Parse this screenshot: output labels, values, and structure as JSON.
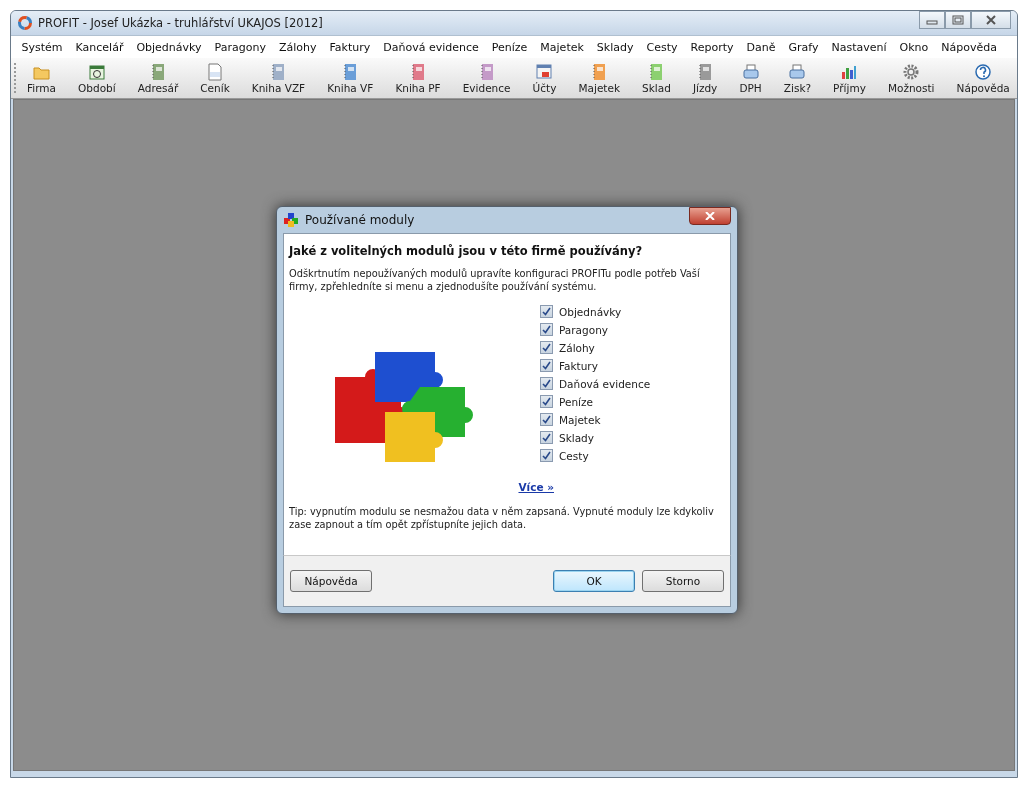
{
  "window": {
    "title": "PROFIT - Josef Ukázka - truhlářství UKAJOS [2012]"
  },
  "menu": [
    "Systém",
    "Kancelář",
    "Objednávky",
    "Paragony",
    "Zálohy",
    "Faktury",
    "Daňová evidence",
    "Peníze",
    "Majetek",
    "Sklady",
    "Cesty",
    "Reporty",
    "Daně",
    "Grafy",
    "Nastavení",
    "Okno",
    "Nápověda"
  ],
  "toolbar": [
    {
      "label": "Firma",
      "kind": "folder"
    },
    {
      "label": "Období",
      "kind": "calendar"
    },
    {
      "label": "Adresář",
      "kind": "book",
      "color": "#8aa87a"
    },
    {
      "label": "Ceník",
      "kind": "pricelist"
    },
    {
      "label": "Kniha VZF",
      "kind": "book",
      "color": "#9fb0c8"
    },
    {
      "label": "Kniha VF",
      "kind": "book",
      "color": "#6a9ed8"
    },
    {
      "label": "Kniha PF",
      "kind": "book",
      "color": "#e07a8a"
    },
    {
      "label": "Evidence",
      "kind": "book",
      "color": "#c49ac8"
    },
    {
      "label": "Účty",
      "kind": "accounts"
    },
    {
      "label": "Majetek",
      "kind": "book",
      "color": "#f0a050"
    },
    {
      "label": "Sklad",
      "kind": "book",
      "color": "#8cd070"
    },
    {
      "label": "Jízdy",
      "kind": "book",
      "color": "#9a9a9a"
    },
    {
      "label": "DPH",
      "kind": "printer"
    },
    {
      "label": "Zisk?",
      "kind": "printer"
    },
    {
      "label": "Příjmy",
      "kind": "chart"
    },
    {
      "label": "Možnosti",
      "kind": "gear"
    },
    {
      "label": "Nápověda",
      "kind": "help"
    }
  ],
  "dialog": {
    "title": "Používané moduly",
    "heading": "Jaké z volitelných modulů jsou v této firmě používány?",
    "description": "Odškrtnutím nepoužívaných modulů upravíte konfiguraci PROFITu podle potřeb Vaší firmy, zpřehledníte si menu a zjednodušíte používání systému.",
    "modules": [
      {
        "label": "Objednávky",
        "checked": true
      },
      {
        "label": "Paragony",
        "checked": true
      },
      {
        "label": "Zálohy",
        "checked": true
      },
      {
        "label": "Faktury",
        "checked": true
      },
      {
        "label": "Daňová evidence",
        "checked": true
      },
      {
        "label": "Peníze",
        "checked": true
      },
      {
        "label": "Majetek",
        "checked": true
      },
      {
        "label": "Sklady",
        "checked": true
      },
      {
        "label": "Cesty",
        "checked": true
      }
    ],
    "more_link": "Více »",
    "tip": "Tip: vypnutím modulu se nesmažou data v něm zapsaná. Vypnuté moduly lze kdykoliv zase zapnout a tím opět zpřístupníte jejich data.",
    "buttons": [
      {
        "label": "Nápověda",
        "kind": "help"
      },
      {
        "label": "OK",
        "kind": "default"
      },
      {
        "label": "Storno",
        "kind": "normal"
      }
    ]
  }
}
